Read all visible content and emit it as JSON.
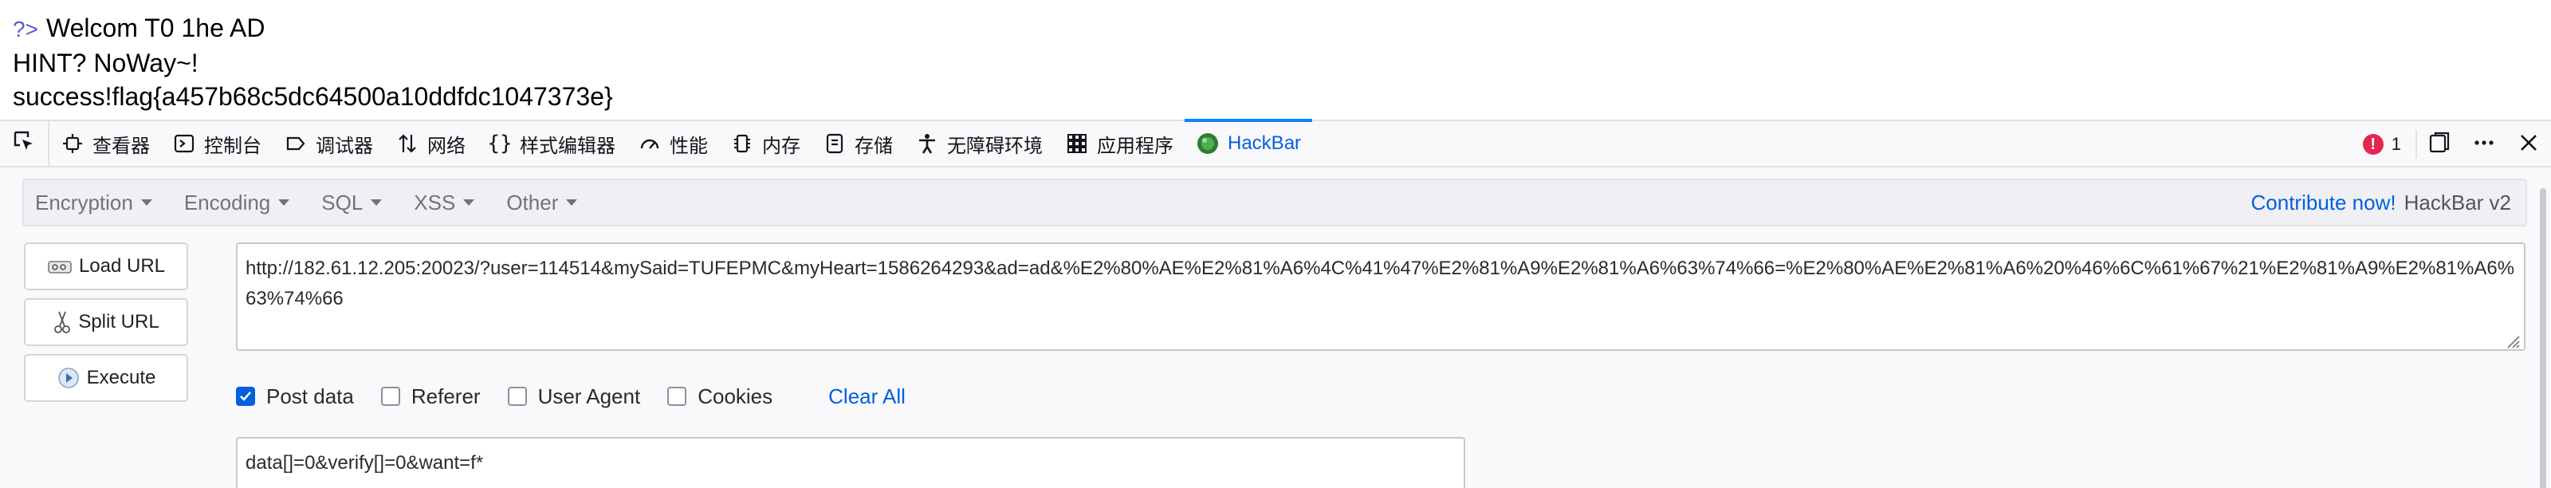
{
  "page": {
    "php_tag": "?>",
    "line1": "Welcom T0 1he AD",
    "line2": "HINT? NoWay~!",
    "line3": "success!flag{a457b68c5dc64500a10ddfdc1047373e}"
  },
  "devtools": {
    "tabs": [
      {
        "label": "查看器",
        "icon": "inspector-icon"
      },
      {
        "label": "控制台",
        "icon": "console-icon"
      },
      {
        "label": "调试器",
        "icon": "debugger-icon"
      },
      {
        "label": "网络",
        "icon": "network-icon"
      },
      {
        "label": "样式编辑器",
        "icon": "style-editor-icon"
      },
      {
        "label": "性能",
        "icon": "performance-icon"
      },
      {
        "label": "内存",
        "icon": "memory-icon"
      },
      {
        "label": "存储",
        "icon": "storage-icon"
      },
      {
        "label": "无障碍环境",
        "icon": "accessibility-icon"
      },
      {
        "label": "应用程序",
        "icon": "application-icon"
      },
      {
        "label": "HackBar",
        "icon": "hackbar-icon",
        "active": true
      }
    ],
    "error_count": "1",
    "accent_color": "#0060df"
  },
  "hackbar": {
    "menus": [
      "Encryption",
      "Encoding",
      "SQL",
      "XSS",
      "Other"
    ],
    "contribute": "Contribute now!",
    "version": "HackBar v2",
    "buttons": {
      "load_url": "Load URL",
      "split_url": "Split URL",
      "execute": "Execute"
    },
    "url": "http://182.61.12.205:20023/?user=114514&mySaid=TUFEPMC&myHeart=1586264293&ad=ad&%E2%80%AE%E2%81%A6%4C%41%47%E2%81%A9%E2%81%A6%63%74%66=%E2%80%AE%E2%81%A6%20%46%6C%61%67%21%E2%81%A9%E2%81%A6%63%74%66",
    "options": {
      "post_data": "Post data",
      "referer": "Referer",
      "user_agent": "User Agent",
      "cookies": "Cookies",
      "clear_all": "Clear All"
    },
    "post_body": "data[]=0&verify[]=0&want=f*"
  }
}
